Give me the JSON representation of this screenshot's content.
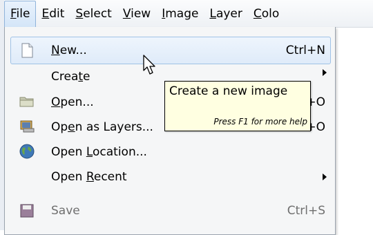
{
  "menubar": {
    "items": [
      {
        "label": "File",
        "mnemonic_index": 0
      },
      {
        "label": "Edit",
        "mnemonic_index": 0
      },
      {
        "label": "Select",
        "mnemonic_index": 0
      },
      {
        "label": "View",
        "mnemonic_index": 0
      },
      {
        "label": "Image",
        "mnemonic_index": 0
      },
      {
        "label": "Layer",
        "mnemonic_index": 0
      },
      {
        "label": "Colo",
        "mnemonic_index": 0
      }
    ]
  },
  "file_menu": {
    "items": [
      {
        "pre": "",
        "mn": "N",
        "post": "ew...",
        "shortcut": "Ctrl+N",
        "icon": "new-document-icon"
      },
      {
        "pre": "Crea",
        "mn": "t",
        "post": "e",
        "shortcut": "",
        "submenu": true
      },
      {
        "pre": "",
        "mn": "O",
        "post": "pen...",
        "shortcut": "Ctrl+O",
        "icon": "folder-icon"
      },
      {
        "pre": "Op",
        "mn": "e",
        "post": "n as Layers...",
        "shortcut": "Ctrl+Alt+O",
        "icon": "open-as-layers-icon"
      },
      {
        "pre": "Open ",
        "mn": "L",
        "post": "ocation...",
        "shortcut": "",
        "icon": "globe-icon"
      },
      {
        "pre": "Open ",
        "mn": "R",
        "post": "ecent",
        "shortcut": "",
        "submenu": true
      },
      {
        "pre": "Save",
        "mn": "",
        "post": "",
        "shortcut": "Ctrl+S",
        "icon": "save-icon"
      }
    ]
  },
  "tooltip": {
    "title": "Create a new image",
    "hint": "Press F1 for more help"
  },
  "colors": {
    "highlight_border": "#9fc2e6",
    "tooltip_bg": "#ffffe1",
    "menu_bg": "#f5f6f7"
  }
}
